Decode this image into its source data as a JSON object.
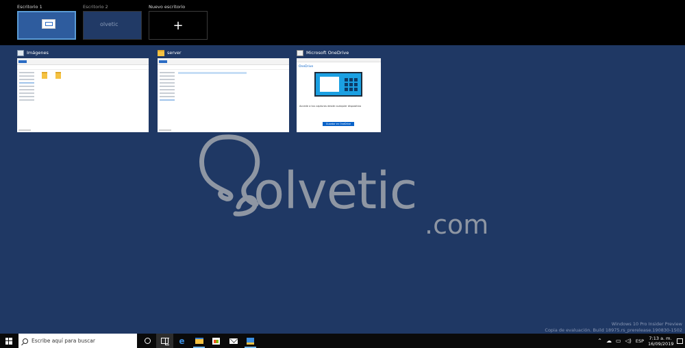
{
  "desktops": [
    {
      "label": "Escritorio 1",
      "active": true
    },
    {
      "label": "Escritorio 2",
      "active": false,
      "thumb_text": "olvetic"
    },
    {
      "label": "Nuevo escritorio",
      "symbol": "+"
    }
  ],
  "windows": [
    {
      "title": "Imágenes",
      "icon": "image-folder-icon"
    },
    {
      "title": "server",
      "icon": "folder-icon"
    },
    {
      "title": "Microsoft OneDrive",
      "icon": "onedrive-icon",
      "brand": "OneDrive",
      "heading": "Accede a tus capturas desde cualquier dispositivo",
      "button": "Guardar en OneDrive"
    }
  ],
  "watermark": {
    "main": "olvetic",
    "suffix": ".com"
  },
  "build_info": {
    "line1": "Windows 10 Pro Insider Preview",
    "line2": "Copia de evaluación. Build 18975.rs_prerelease.190830-1502"
  },
  "taskbar": {
    "search_placeholder": "Escribe aquí para buscar",
    "language": "ESP",
    "time": "7:13 a. m.",
    "date": "16/09/2019"
  },
  "colors": {
    "desktop_bg": "#1f3864",
    "taskbar_bg": "#0a0a0a",
    "accent": "#5b9bd5"
  }
}
